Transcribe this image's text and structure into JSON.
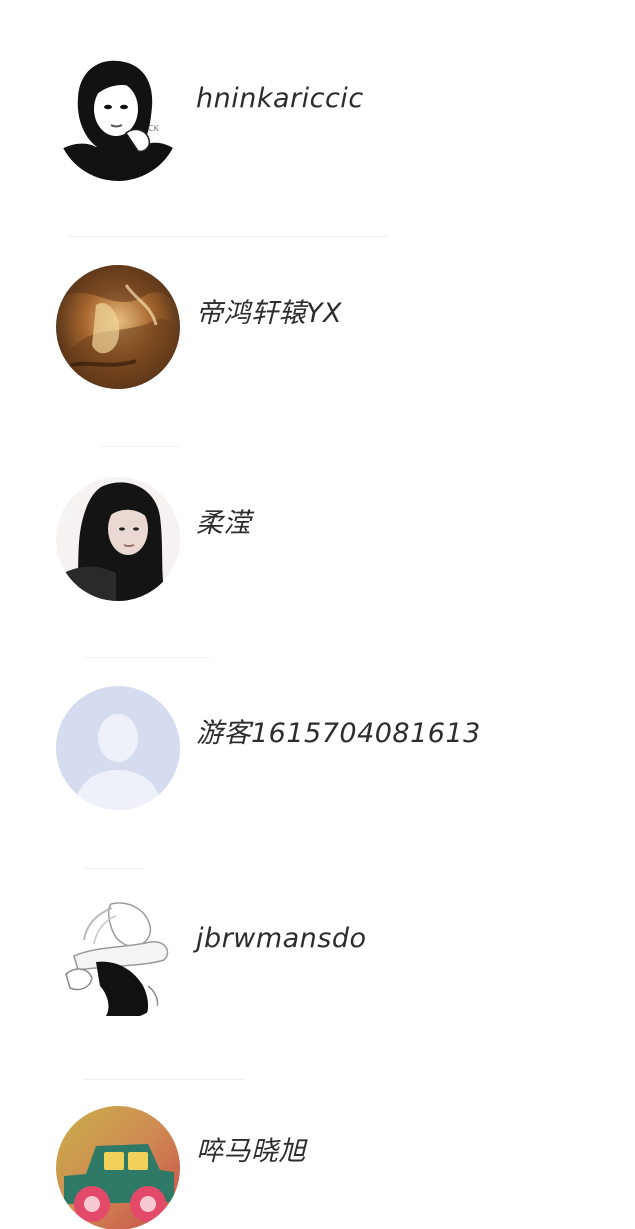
{
  "users": [
    {
      "name": "hninkariccic",
      "avatar_icon": "girl-sketch-avatar"
    },
    {
      "name": "帝鸿轩辕YX",
      "avatar_icon": "painting-avatar"
    },
    {
      "name": "柔滢",
      "avatar_icon": "girl-photo-avatar"
    },
    {
      "name": "游客1615704081613",
      "avatar_icon": "default-person-avatar"
    },
    {
      "name": "jbrwmansdo",
      "avatar_icon": "sketch-figure-avatar"
    },
    {
      "name": "啐马晓旭",
      "avatar_icon": "toy-car-avatar"
    }
  ]
}
